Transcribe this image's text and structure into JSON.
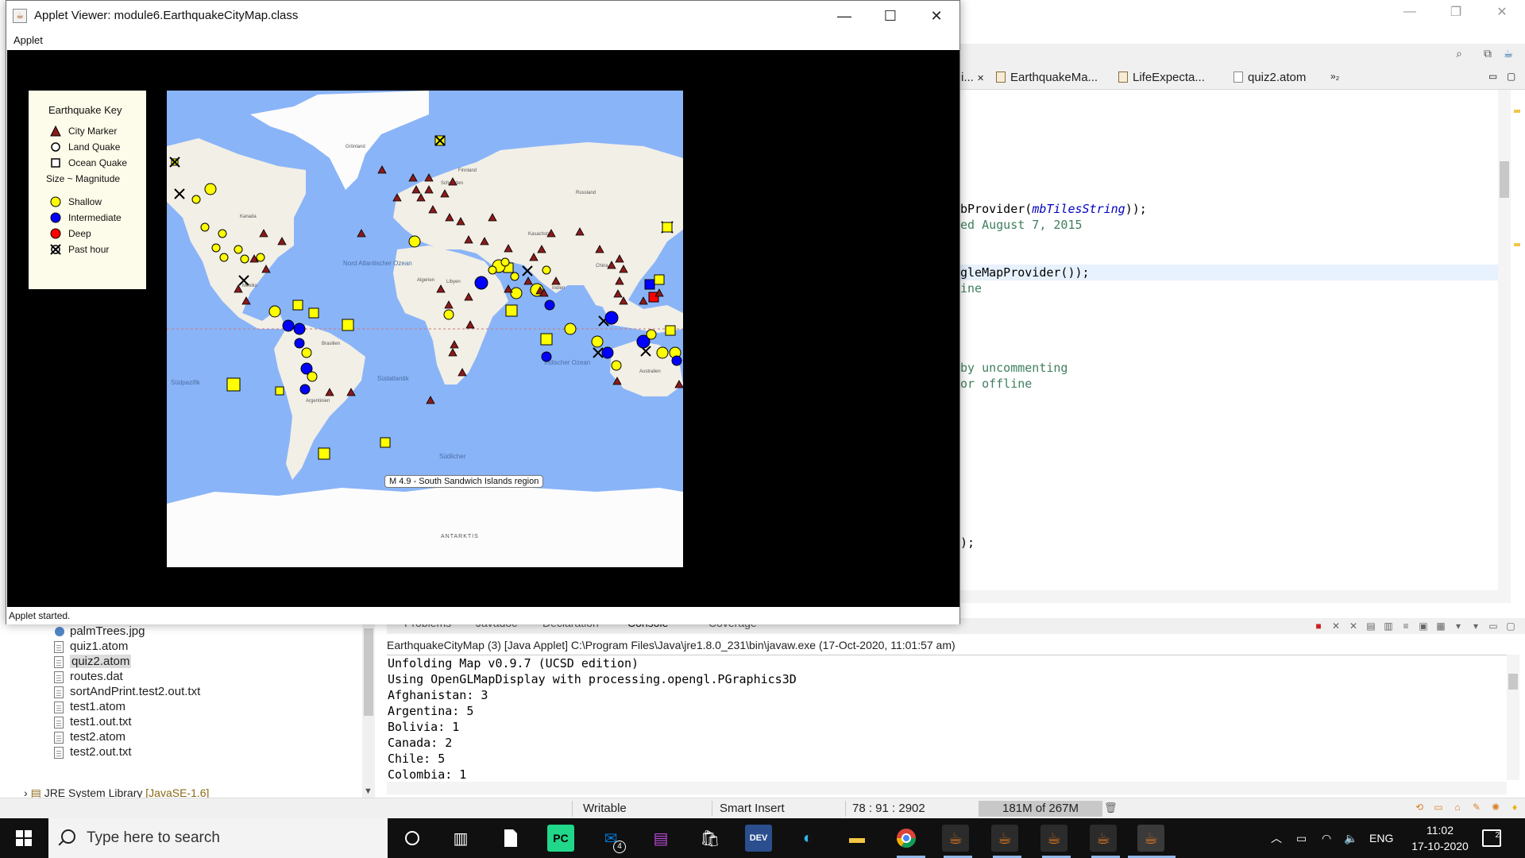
{
  "eclipse": {
    "editor_tabs": [
      {
        "label": "i..."
      },
      {
        "label": "EarthquakeMa..."
      },
      {
        "label": "LifeExpecta..."
      },
      {
        "label": "quiz2.atom"
      },
      {
        "label": "»₂"
      }
    ],
    "code_lines": [
      {
        "segments": [
          {
            "text": "bProvider(",
            "style": "plain"
          },
          {
            "text": "mbTilesString",
            "style": "ital"
          },
          {
            "text": "));",
            "style": "plain"
          }
        ]
      },
      {
        "segments": [
          {
            "text": "ed August 7, 2015",
            "style": "comment"
          }
        ]
      },
      {
        "segments": [
          {
            "text": "gleMapProvider());",
            "style": "plain"
          }
        ]
      },
      {
        "segments": [
          {
            "text": "ine",
            "style": "comment"
          }
        ]
      },
      {
        "segments": [
          {
            "text": "by uncommenting",
            "style": "comment"
          }
        ]
      },
      {
        "segments": [
          {
            "text": "or offline",
            "style": "comment"
          }
        ]
      },
      {
        "segments": [
          {
            "text": ");",
            "style": "plain"
          }
        ]
      }
    ],
    "explorer_items": [
      {
        "label": "palmTrees.jpg",
        "kind": "image"
      },
      {
        "label": "quiz1.atom",
        "kind": "file"
      },
      {
        "label": "quiz2.atom",
        "kind": "file",
        "selected": true
      },
      {
        "label": "routes.dat",
        "kind": "file"
      },
      {
        "label": "sortAndPrint.test2.out.txt",
        "kind": "file"
      },
      {
        "label": "test1.atom",
        "kind": "file"
      },
      {
        "label": "test1.out.txt",
        "kind": "file"
      },
      {
        "label": "test2.atom",
        "kind": "file"
      },
      {
        "label": "test2.out.txt",
        "kind": "file"
      }
    ],
    "jre_label": "JRE System Library",
    "jre_version": "[JavaSE-1.6]",
    "console_tabs": [
      "Problems",
      "Javadoc",
      "Declaration",
      "Console",
      "Coverage"
    ],
    "console_title": "EarthquakeCityMap (3) [Java Applet] C:\\Program Files\\Java\\jre1.8.0_231\\bin\\javaw.exe (17-Oct-2020, 11:01:57 am)",
    "console_lines": [
      "Unfolding Map v0.9.7 (UCSD edition)",
      "Using OpenGLMapDisplay with processing.opengl.PGraphics3D",
      "Afghanistan: 3",
      "Argentina: 5",
      "Bolivia: 1",
      "Canada: 2",
      "Chile: 5",
      "Colombia: 1"
    ],
    "status": {
      "writable": "Writable",
      "insert_mode": "Smart Insert",
      "position": "78 : 91 : 2902",
      "heap": "181M of 267M"
    }
  },
  "applet": {
    "title": "Applet Viewer: module6.EarthquakeCityMap.class",
    "menu": "Applet",
    "status": "Applet started.",
    "key": {
      "title": "Earthquake Key",
      "city": "City Marker",
      "land": "Land Quake",
      "ocean": "Ocean Quake",
      "size": "Size ~ Magnitude",
      "shallow": "Shallow",
      "intermediate": "Intermediate",
      "deep": "Deep",
      "past_hour": "Past hour"
    },
    "map_labels": {
      "greenland": "Grönland",
      "north_atlantic": "Nord Atlantischer Ozean",
      "south_atlantic": "Südatlantik",
      "south_pacific": "Südpazifik",
      "indian_ocean": "Indischer Ozean",
      "southern_ocean": "Südlicher",
      "antarctica": "ANTARKTIS",
      "kanada": "Kanada",
      "brasilien": "Brasilien",
      "russland": "Russland",
      "china": "China",
      "australien": "Australien",
      "algerien": "Algerien",
      "libyen": "Libyen",
      "indien": "Indien",
      "kasachstan": "Kasachstan",
      "mexiko": "Mexiko",
      "argentinien": "Argentinien",
      "finnland": "Finnland",
      "schweden": "Schweden"
    },
    "tooltip": "M 4.9 - South Sandwich Islands region",
    "colors": {
      "shallow": "#ffff00",
      "intermediate": "#0000ff",
      "deep": "#ff0000",
      "city": "#8b1a1a",
      "ocean": "#8ab4f8",
      "land": "#f2efe6",
      "ice": "#fcfcfc"
    }
  },
  "taskbar": {
    "search_placeholder": "Type here to search",
    "apps": [
      "task-view",
      "notepad",
      "pycharm",
      "mail",
      "terminal",
      "store",
      "dev-cpp",
      "edge",
      "file-explorer",
      "chrome",
      "java",
      "java",
      "java",
      "java",
      "java"
    ],
    "mail_badge": "4",
    "language": "ENG",
    "time": "11:02",
    "date": "17-10-2020",
    "notification_count": "2"
  }
}
